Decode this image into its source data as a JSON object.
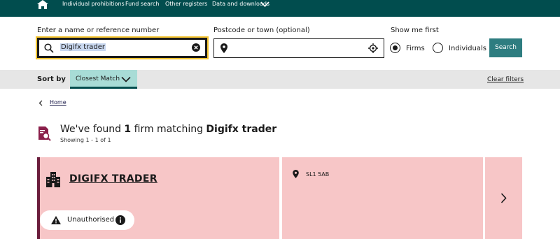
{
  "nav": {
    "items": [
      "Individual prohibitions",
      "Fund search",
      "Other registers",
      "Data and downloads"
    ]
  },
  "search": {
    "name_label": "Enter a name or reference number",
    "name_value": "Digifx trader",
    "postcode_label": "Postcode or town (optional)",
    "postcode_value": "",
    "show_label": "Show me first",
    "options": [
      "Firms",
      "Individuals"
    ],
    "selected": "Firms",
    "button": "Search"
  },
  "sort": {
    "label": "Sort by",
    "selected": "Closest Match",
    "clear_filters": "Clear filters"
  },
  "breadcrumb": {
    "home": "Home"
  },
  "results": {
    "heading_prefix": "We've found",
    "count": "1",
    "heading_middle": "firm matching",
    "query": "Digifx trader",
    "showing": "Showing 1 - 1 of 1"
  },
  "card": {
    "firm_name": "DIGIFX TRADER",
    "status": "Unauthorised",
    "postcode": "SL1 5AB"
  },
  "colors": {
    "topbar": "#014d4e",
    "search_button": "#2e7d80",
    "sort_select": "#a8dcd6",
    "card_bg": "#f7c6c7",
    "card_accent": "#6b1d3c"
  }
}
